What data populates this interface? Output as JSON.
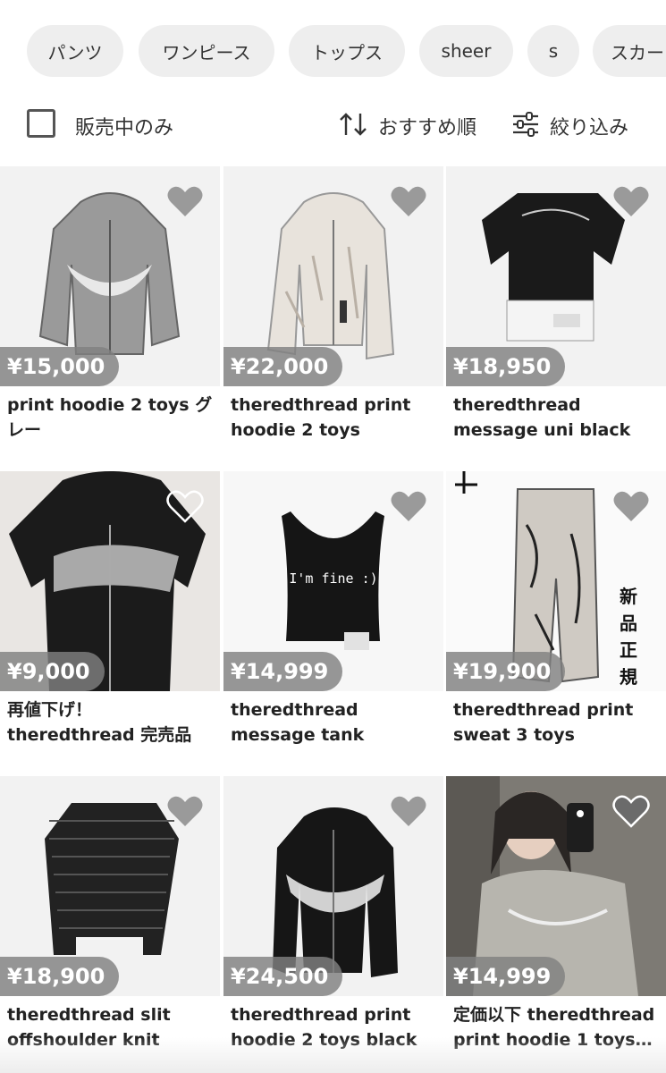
{
  "chips": [
    "パンツ",
    "ワンピース",
    "トップス",
    "sheer",
    "s",
    "スカート"
  ],
  "toolbar": {
    "checkbox_label": "販売中のみ",
    "sort_label": "おすすめ順",
    "filter_label": "絞り込み"
  },
  "items": [
    {
      "price": "¥15,000",
      "title": "print hoodie 2 toys グレー"
    },
    {
      "price": "¥22,000",
      "title": "theredthread print hoodie 2 toys"
    },
    {
      "price": "¥18,950",
      "title": "theredthread message uni black"
    },
    {
      "price": "¥9,000",
      "title": "再値下げ！theredthread 完売品"
    },
    {
      "price": "¥14,999",
      "title": "theredthread message tank"
    },
    {
      "price": "¥19,900",
      "title": "theredthread print sweat 3 toys"
    },
    {
      "price": "¥18,900",
      "title": "theredthread slit offshoulder knit"
    },
    {
      "price": "¥24,500",
      "title": "theredthread print hoodie 2 toys black"
    },
    {
      "price": "¥14,999",
      "title": "定価以下 theredthread print hoodie 1 toys…"
    }
  ],
  "image_text": {
    "tank_print": "I'm fine :)",
    "new_label": "新品正規品"
  },
  "colors": {
    "price_badge": "#808080",
    "chip_bg": "#eeeeee",
    "heart": "#9a9a9a"
  }
}
